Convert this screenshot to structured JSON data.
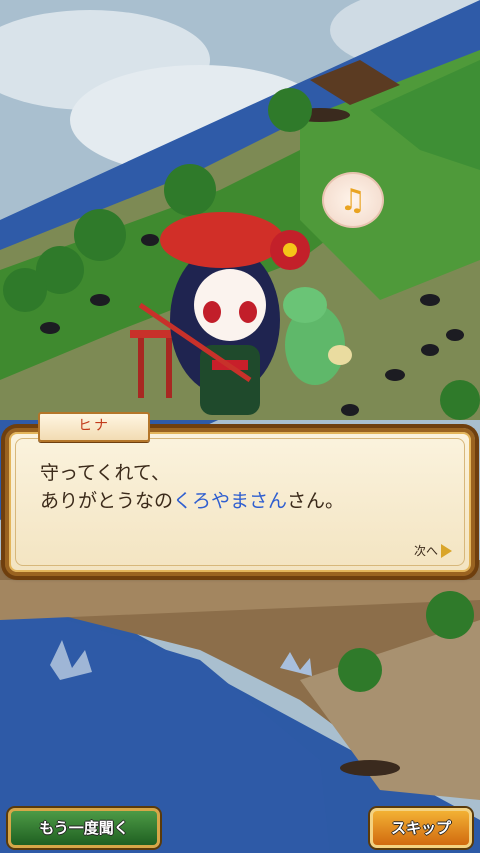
{
  "dialogue": {
    "speaker": "ヒナ",
    "line1": "守ってくれて、",
    "line2_before": "ありがとうなの",
    "line2_highlight": "くろやまさん",
    "line2_after": "さん。",
    "next_label": "次へ"
  },
  "buttons": {
    "replay_label": "もう一度聞く",
    "skip_label": "スキップ"
  },
  "icons": {
    "music_note": "♫",
    "next_arrow": "triangle-right"
  },
  "colors": {
    "highlight_name": "#2f5fd0",
    "speaker_name": "#c23a1a",
    "skip_button": "#e38a1f",
    "replay_button": "#3d8a3a"
  }
}
